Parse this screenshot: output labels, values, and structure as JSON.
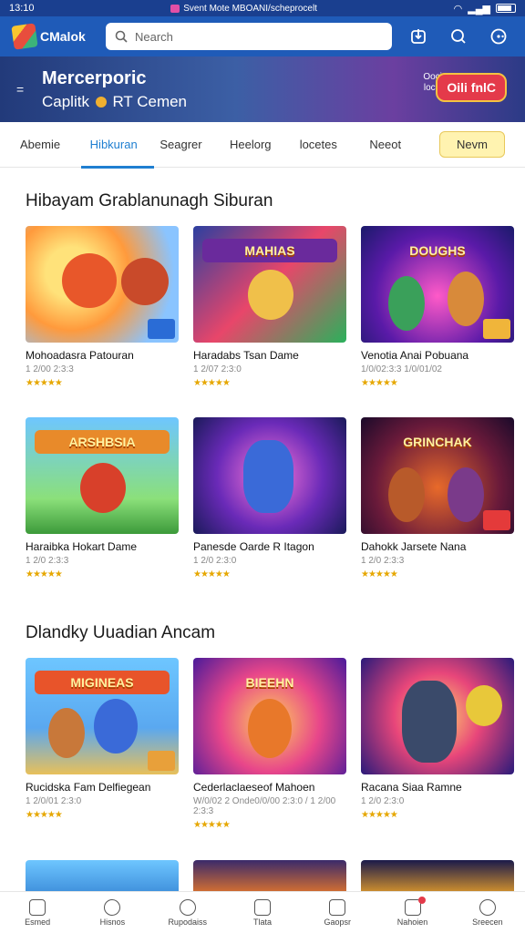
{
  "status_bar": {
    "time": "13:10",
    "center_text": "Svent Mote MBOANI/scheprocelt"
  },
  "app": {
    "logo_text": "CMalok",
    "search_placeholder": "Nearch"
  },
  "banner": {
    "title_line1": "Mercerporic",
    "title_line2_a": "Caplitk",
    "title_line2_b": "RT Cemen",
    "promo_line1": "Oocion",
    "promo_line2": "locatcs",
    "cta": "Oili fnlC"
  },
  "tabs": [
    {
      "label": "Abemie",
      "active": false
    },
    {
      "label": "Hibkuran",
      "active": true
    },
    {
      "label": "Seagrer",
      "active": false
    },
    {
      "label": "Heelorg",
      "active": false
    },
    {
      "label": "locetes",
      "active": false
    },
    {
      "label": "Neeot",
      "active": false
    }
  ],
  "tab_button": "Nevm",
  "sections": [
    {
      "title": "Hibayam Grablanunagh Siburan",
      "cards": [
        {
          "title": "Mohoadasra Patouran",
          "sub": "1 2/00 2:3:3",
          "stars": "★★★★★"
        },
        {
          "title": "Haradabs Tsan Dame",
          "sub": "1 2/07 2:3:0",
          "stars": "★★★★★"
        },
        {
          "title": "Venotia Anai Pobuana",
          "sub": "1/0/02:3:3 1/0/01/02",
          "stars": "★★★★★"
        },
        {
          "title": "Haraibka Hokart Dame",
          "sub": "1 2/0 2:3:3",
          "stars": "★★★★★"
        },
        {
          "title": "Panesde Oarde R Itagon",
          "sub": "1 2/0 2:3:0",
          "stars": "★★★★★"
        },
        {
          "title": "Dahokk Jarsete Nana",
          "sub": "1 2/0 2:3:3",
          "stars": "★★★★★"
        }
      ]
    },
    {
      "title": "Dlandky Uuadian Ancam",
      "cards": [
        {
          "title": "Rucidska Fam Delfiegean",
          "sub": "1 2/0/01 2:3:0",
          "stars": "★★★★★"
        },
        {
          "title": "Cederlaclaeseof Mahoen",
          "sub": "W/0/02 2 Onde0/0/00 2:3:0 / 1 2/00 2:3:3",
          "stars": "★★★★★"
        },
        {
          "title": "Racana Siaa Ramne",
          "sub": "1 2/0 2:3:0",
          "stars": "★★★★★"
        }
      ]
    }
  ],
  "bottom_nav": [
    {
      "label": "Esmed",
      "icon": "home-icon"
    },
    {
      "label": "Hisnos",
      "icon": "disc-icon"
    },
    {
      "label": "Rupodaiss",
      "icon": "compass-icon"
    },
    {
      "label": "Tlata",
      "icon": "text-icon"
    },
    {
      "label": "Gaopsr",
      "icon": "bag-icon"
    },
    {
      "label": "Nahoien",
      "icon": "chat-icon"
    },
    {
      "label": "Sreecen",
      "icon": "user-icon"
    }
  ],
  "colors": {
    "primary": "#1f5bb8",
    "accent": "#1f7fd1",
    "cta": "#e43a4a"
  }
}
